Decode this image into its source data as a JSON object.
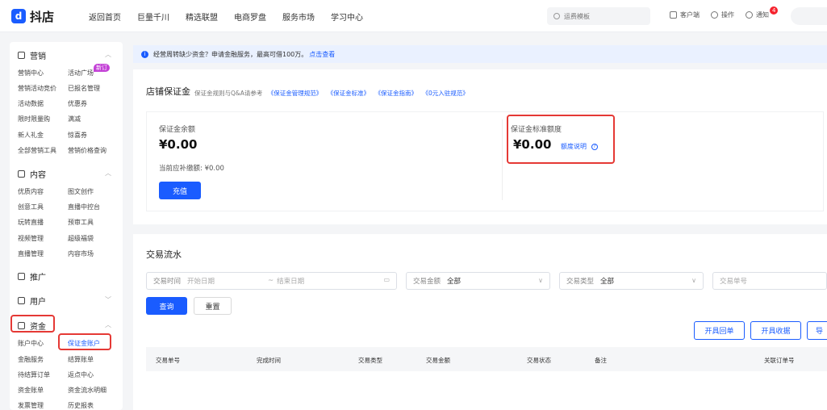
{
  "header": {
    "logo_mark": "d",
    "logo_text": "抖店",
    "nav": [
      "返回首页",
      "巨量千川",
      "精选联盟",
      "电商罗盘",
      "服务市场",
      "学习中心"
    ],
    "search_placeholder": "运费模板",
    "tools": [
      "客户端",
      "操作",
      "通知"
    ],
    "notification_count": "4"
  },
  "sidebar": {
    "sections": [
      {
        "title": "营销",
        "icon": "megaphone-icon",
        "items": [
          "营销中心",
          "活动广场",
          "营销活动竞价",
          "已报名管理",
          "活动数据",
          "优惠券",
          "限时限量购",
          "满减",
          "新人礼金",
          "惊喜券",
          "全部营销工具",
          "营销价格查询"
        ],
        "badge": "新订"
      },
      {
        "title": "内容",
        "icon": "content-icon",
        "items": [
          "优质内容",
          "图文创作",
          "创意工具",
          "直播中控台",
          "玩转直播",
          "预审工具",
          "视频管理",
          "超级福袋",
          "直播管理",
          "内容市场"
        ]
      },
      {
        "title": "推广",
        "icon": "promote-icon",
        "items": []
      },
      {
        "title": "用户",
        "icon": "user-icon",
        "items": []
      },
      {
        "title": "资金",
        "icon": "wallet-icon",
        "items": [
          "账户中心",
          "保证金账户",
          "金融服务",
          "结算账单",
          "待结算订单",
          "返点中心",
          "资金账单",
          "资金流水明细",
          "发票管理",
          "历史报表"
        ]
      }
    ]
  },
  "notice": {
    "text": "经营周转缺少资金？申请金融服务，最高可借100万。",
    "link": "点击查看"
  },
  "deposit": {
    "title": "店铺保证金",
    "ref_prefix": "保证金规则与Q&A请参考",
    "ref_links": [
      "《保证金管理规范》",
      "《保证金标准》",
      "《保证金指南》",
      "《0元入驻规范》"
    ],
    "balance_label": "保证金余额",
    "balance_value": "¥0.00",
    "due_label": "当前应补缴额: ¥0.00",
    "recharge": "充值",
    "standard_label": "保证金标准额度",
    "standard_value": "¥0.00",
    "quota_link": "额度说明",
    "quota_icon": "?"
  },
  "transactions": {
    "title": "交易流水",
    "filters": {
      "time_label": "交易时间",
      "start_placeholder": "开始日期",
      "sep": "~",
      "end_placeholder": "结束日期",
      "amount_label": "交易金额",
      "amount_value": "全部",
      "type_label": "交易类型",
      "type_value": "全部",
      "no_placeholder": "交易单号"
    },
    "query": "查询",
    "reset": "重置",
    "actions": [
      "开具回单",
      "开具收据",
      "导"
    ],
    "columns": [
      "交易单号",
      "完成时间",
      "交易类型",
      "交易金额",
      "交易状态",
      "备注",
      "关联订单号"
    ]
  }
}
